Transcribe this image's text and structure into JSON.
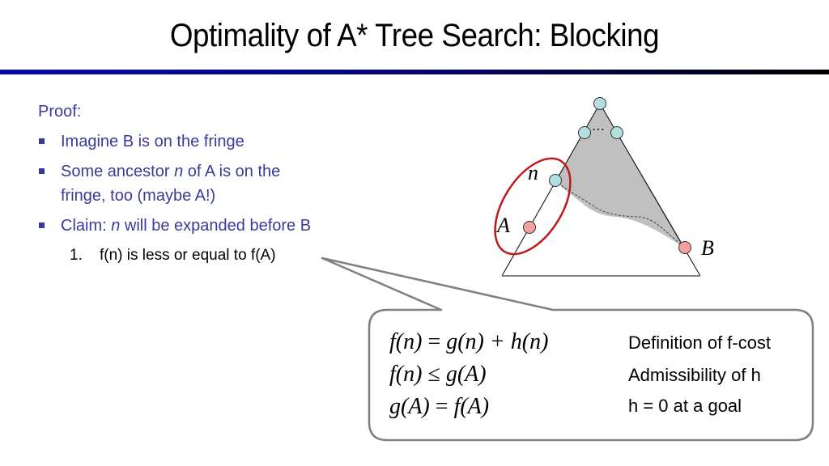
{
  "slide": {
    "title": "Optimality of A* Tree Search: Blocking",
    "proof_label": "Proof:",
    "bullets": [
      {
        "text": "Imagine B is on the fringe"
      },
      {
        "pre": "Some ancestor ",
        "em": "n",
        "post": " of A is on the",
        "line2": "fringe, too (maybe A!)"
      },
      {
        "pre": "Claim: ",
        "em": "n",
        "post": " will be expanded before B"
      }
    ],
    "numbered_item": {
      "number": "1.",
      "text": "f(n) is less or equal to f(A)"
    },
    "colors": {
      "bullet_text": "#3a3a9a",
      "node_teal": "#b3dfe0",
      "node_red": "#f2a0a0",
      "ellipse": "#c01818",
      "shade": "#c0c0c0"
    }
  },
  "diagram": {
    "labels": {
      "n": "n",
      "A": "A",
      "B": "B",
      "dots": "…"
    }
  },
  "callout": {
    "rows": [
      {
        "lhs": "f(n)",
        "op": "=",
        "rhs": "g(n) + h(n)",
        "reason": "Definition of f-cost"
      },
      {
        "lhs": "f(n)",
        "op": "≤",
        "rhs": "g(A)",
        "reason": "Admissibility of h"
      },
      {
        "lhs": "g(A)",
        "op": "=",
        "rhs": "f(A)",
        "reason": "h = 0 at a goal"
      }
    ]
  }
}
